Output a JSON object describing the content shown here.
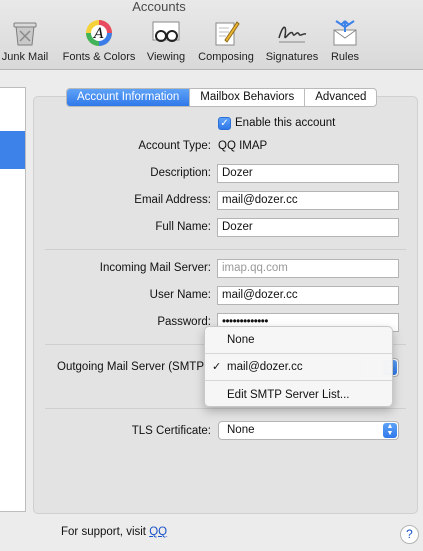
{
  "window": {
    "title": "Accounts"
  },
  "toolbar": {
    "items": [
      {
        "label": "Junk Mail",
        "icon": "junk-mail-icon"
      },
      {
        "label": "Fonts & Colors",
        "icon": "fonts-colors-icon"
      },
      {
        "label": "Viewing",
        "icon": "viewing-icon"
      },
      {
        "label": "Composing",
        "icon": "composing-icon"
      },
      {
        "label": "Signatures",
        "icon": "signatures-icon"
      },
      {
        "label": "Rules",
        "icon": "rules-icon"
      }
    ]
  },
  "tabs": [
    {
      "label": "Account Information",
      "active": true
    },
    {
      "label": "Mailbox Behaviors",
      "active": false
    },
    {
      "label": "Advanced",
      "active": false
    }
  ],
  "account": {
    "enable_label": "Enable this account",
    "enabled": true,
    "type_label": "Account Type:",
    "type_value": "QQ IMAP",
    "description_label": "Description:",
    "description_value": "Dozer",
    "email_label": "Email Address:",
    "email_value": "mail@dozer.cc",
    "fullname_label": "Full Name:",
    "fullname_value": "Dozer"
  },
  "server": {
    "incoming_label": "Incoming Mail Server:",
    "incoming_placeholder": "imap.qq.com",
    "username_label": "User Name:",
    "username_value": "mail@dozer.cc",
    "password_label": "Password:",
    "password_value": "•••••••••••••",
    "outgoing_label": "Outgoing Mail Server (SMTP"
  },
  "smtp_menu": {
    "items": [
      {
        "label": "None",
        "checked": false
      },
      {
        "label": "mail@dozer.cc",
        "checked": true
      },
      {
        "label": "Edit SMTP Server List...",
        "checked": false
      }
    ],
    "check_glyph": "✓"
  },
  "tls": {
    "label": "TLS Certificate:",
    "value": "None"
  },
  "footer": {
    "support_text": "For support, visit ",
    "support_link": "QQ",
    "help_glyph": "?"
  },
  "colors": {
    "accent": "#3d82e9",
    "link": "#1b52c9"
  }
}
